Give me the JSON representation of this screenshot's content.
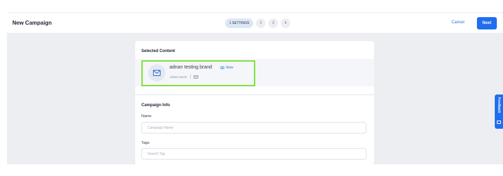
{
  "header": {
    "title": "New Campaign",
    "steps": [
      "1 SETTINGS",
      "2",
      "3",
      "4"
    ],
    "cancel_label": "Cancel",
    "next_label": "Next"
  },
  "selected_content": {
    "section_title": "Selected Content",
    "name": "adnan testing brand",
    "view_label": "View",
    "owner": "Adnan Munir",
    "icon": "email-icon"
  },
  "campaign_info": {
    "section_title": "Campaign Info",
    "name_label": "Name",
    "name_placeholder": "Campaign Name",
    "tags_label": "Tags",
    "tags_placeholder": "Search Tag"
  },
  "feedback": {
    "label": "Feedback"
  },
  "colors": {
    "accent": "#1f6ef0",
    "highlight": "#7ee13b",
    "canvas": "#eceef1"
  }
}
